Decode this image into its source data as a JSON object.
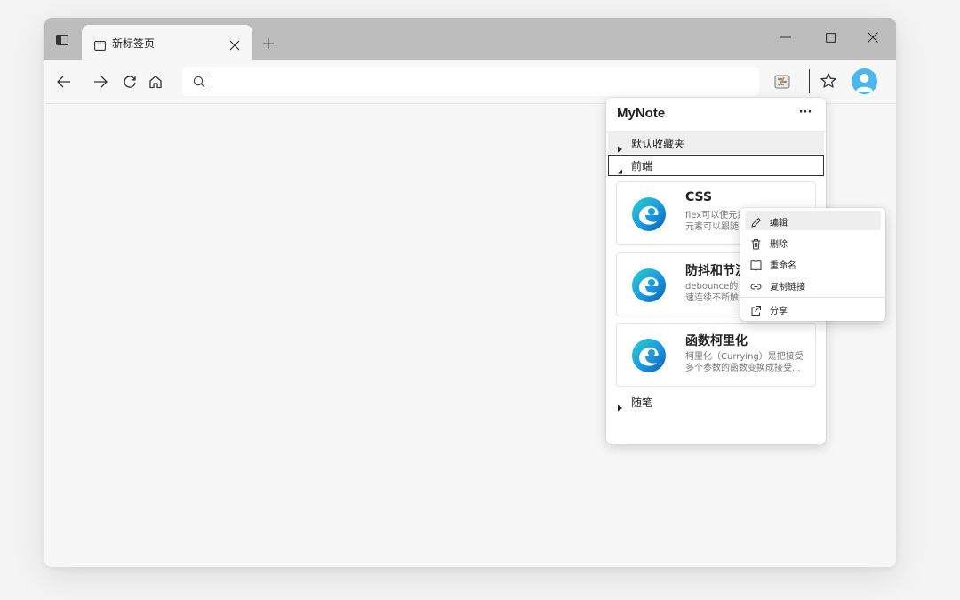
{
  "browser": {
    "tab_title": "新标签页",
    "address_value": "",
    "colors": {
      "titlebar": "#bdbdbd",
      "page": "#f7f7f7",
      "avatar": "#4cb6f0"
    }
  },
  "panel": {
    "title": "MyNote",
    "more_label": "···",
    "folders": [
      {
        "label": "默认收藏夹",
        "expanded": false
      },
      {
        "label": "前端",
        "expanded": true
      },
      {
        "label": "随笔",
        "expanded": false
      }
    ],
    "cards": [
      {
        "title": "CSS",
        "desc_line1": "flex可以使元素",
        "desc_line2": "元素可以跟随",
        "icon": "edge-logo-icon"
      },
      {
        "title": "防抖和节流",
        "desc_line1": "debounce的",
        "desc_line2": "速连续不断触",
        "icon": "edge-logo-icon"
      },
      {
        "title": "函数柯里化",
        "desc_line1": "柯里化（Currying）是把接受",
        "desc_line2": "多个参数的函数变换成接受...",
        "icon": "edge-logo-icon"
      }
    ]
  },
  "context_menu": {
    "items": [
      {
        "label": "编辑",
        "icon": "pencil-icon"
      },
      {
        "label": "删除",
        "icon": "trash-icon"
      },
      {
        "label": "重命名",
        "icon": "book-icon"
      },
      {
        "label": "复制链接",
        "icon": "link-icon"
      },
      {
        "label": "分享",
        "icon": "share-icon"
      }
    ]
  }
}
